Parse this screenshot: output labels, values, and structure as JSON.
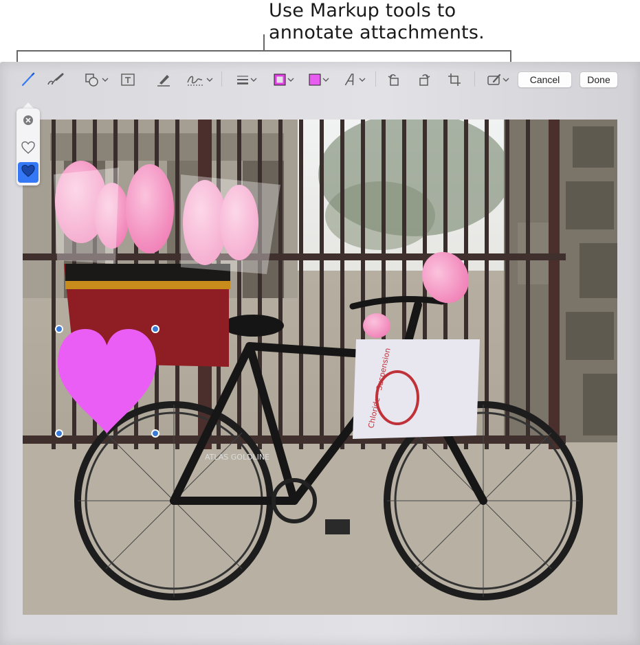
{
  "callout": {
    "line1": "Use Markup tools to",
    "line2": "annotate attachments."
  },
  "toolbar": {
    "tools": [
      {
        "name": "sketch-icon",
        "active": true
      },
      {
        "name": "draw-icon"
      },
      {
        "name": "shapes-icon",
        "has_menu": true
      },
      {
        "name": "text-icon"
      },
      {
        "name": "highlight-icon"
      },
      {
        "name": "sign-icon",
        "has_menu": true
      },
      {
        "name": "line-style-icon",
        "has_menu": true
      },
      {
        "name": "border-color-icon",
        "has_menu": true
      },
      {
        "name": "fill-color-icon",
        "has_menu": true
      },
      {
        "name": "text-style-icon",
        "has_menu": true
      },
      {
        "name": "rotate-left-icon"
      },
      {
        "name": "rotate-right-icon"
      },
      {
        "name": "crop-icon"
      },
      {
        "name": "annotate-icon",
        "has_menu": true
      }
    ],
    "border_color": "#e040e0",
    "fill_color": "#e85cf0",
    "cancel_label": "Cancel",
    "done_label": "Done"
  },
  "shape_popover": {
    "items": [
      {
        "name": "close-icon"
      },
      {
        "name": "heart-outline-icon"
      },
      {
        "name": "heart-filled-icon",
        "selected": true
      }
    ]
  },
  "heart_annotation": {
    "fill": "#ea5ef5",
    "handle_color": "#3a7bd5"
  },
  "accent_color": "#3478f6"
}
